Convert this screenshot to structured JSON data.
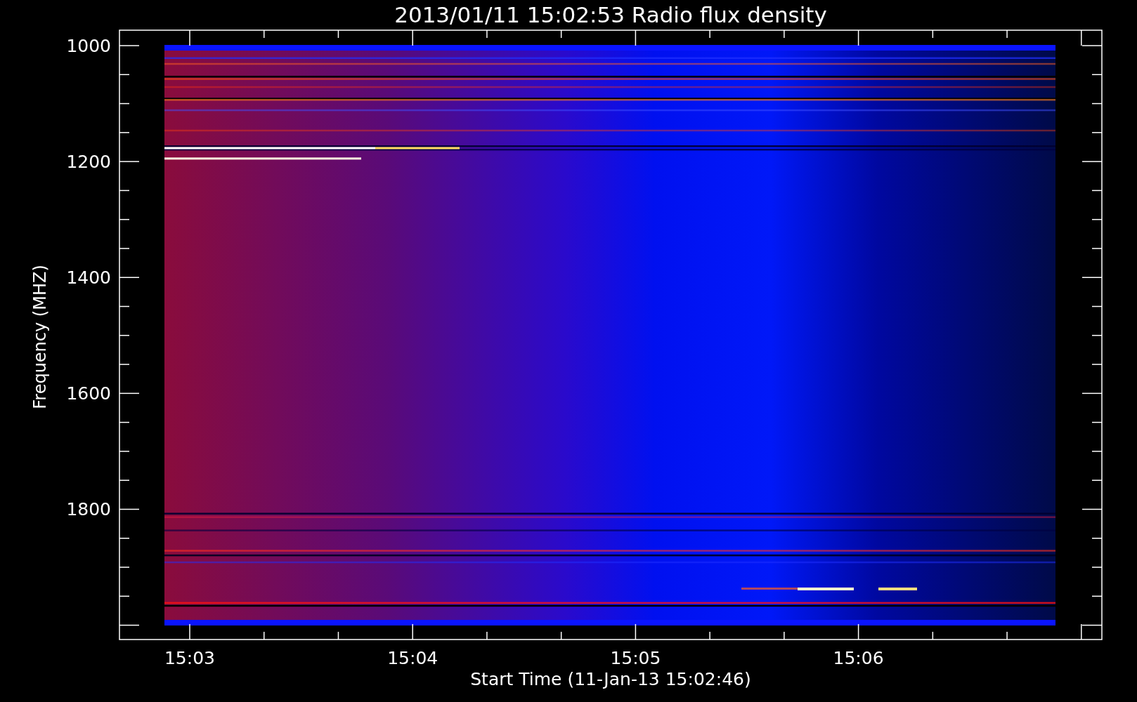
{
  "title": "2013/01/11 15:02:53 Radio flux density",
  "y_axis": {
    "label": "Frequency (MHZ)",
    "ticks": [
      "1000",
      "1200",
      "1400",
      "1600",
      "1800"
    ]
  },
  "x_axis": {
    "label": "Start Time (11-Jan-13 15:02:46)",
    "ticks": [
      "15:03",
      "15:04",
      "15:05",
      "15:06"
    ]
  }
}
